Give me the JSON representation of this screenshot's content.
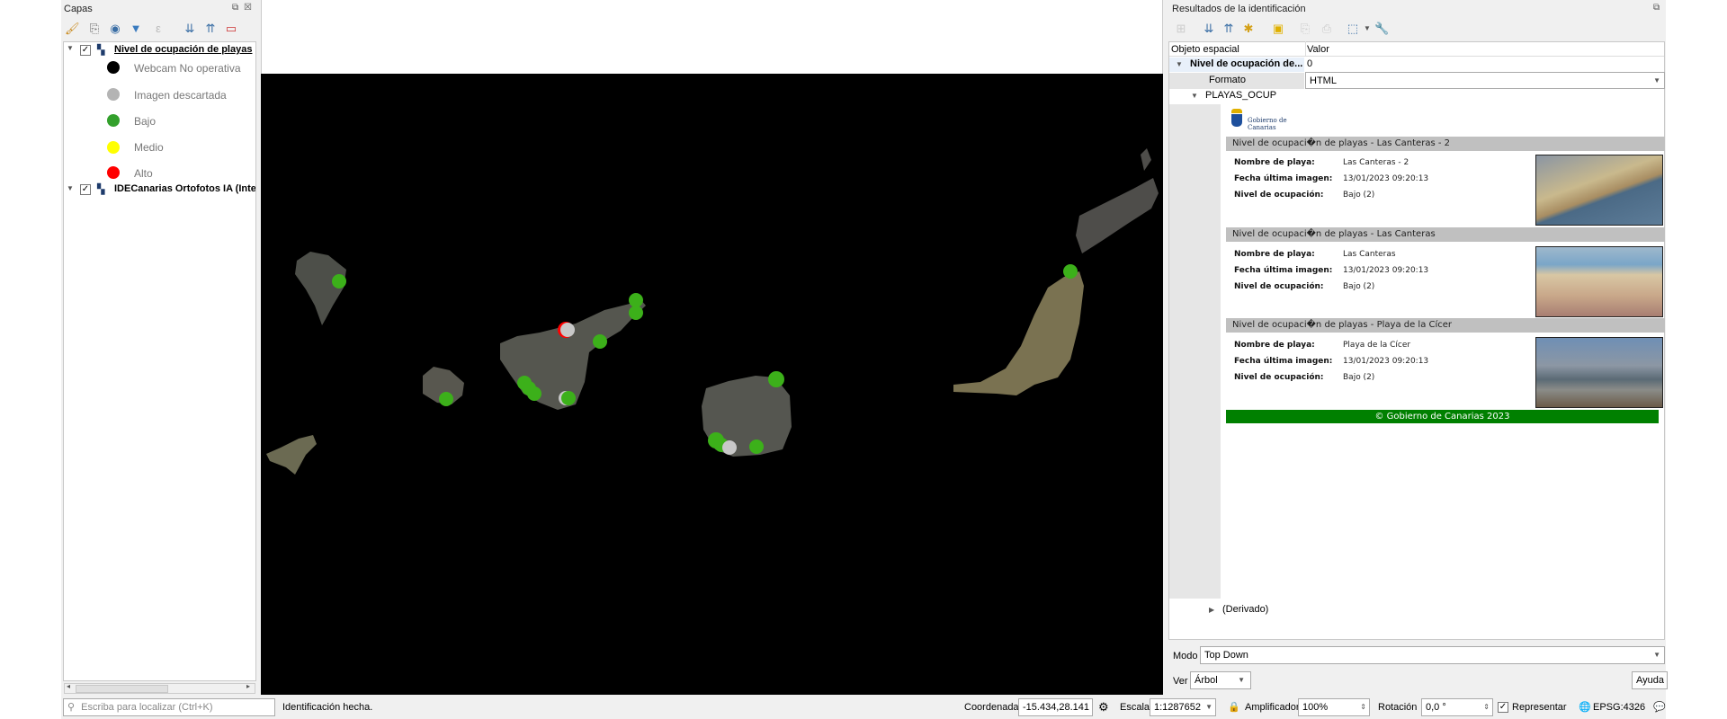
{
  "layers_panel": {
    "title": "Capas",
    "toolbar_icons": [
      "style-brush-icon",
      "add-group-icon",
      "eye-visibility-icon",
      "filter-icon",
      "expression-filter-icon",
      "expand-all-icon",
      "collapse-all-icon",
      "remove-layer-icon"
    ],
    "layers": [
      {
        "name": "Nivel de ocupación de playas",
        "checked": true,
        "legend": [
          {
            "label": "Webcam No operativa",
            "color": "#000000"
          },
          {
            "label": "Imagen descartada",
            "color": "#b4b4b4"
          },
          {
            "label": "Bajo",
            "color": "#33a02c"
          },
          {
            "label": "Medio",
            "color": "#ffff00"
          },
          {
            "label": "Alto",
            "color": "#ff0000"
          }
        ]
      },
      {
        "name": "IDECanarias Ortofotos IA (Inte",
        "checked": true
      }
    ]
  },
  "results_panel": {
    "title": "Resultados de la identificación",
    "columns": [
      "Objeto espacial",
      "Valor"
    ],
    "layer_row": {
      "name": "Nivel de ocupación de...",
      "value": "0"
    },
    "format_row": {
      "label": "Formato",
      "value": "HTML"
    },
    "feature": "PLAYAS_OCUP",
    "logo_text": "Gobierno de Canarias",
    "records": [
      {
        "title": "Nivel de ocupaci�n de playas - Las Canteras - 2",
        "nombre": "Las Canteras - 2",
        "fecha": "13/01/2023 09:20:13",
        "nivel": "Bajo (2)"
      },
      {
        "title": "Nivel de ocupaci�n de playas - Las Canteras",
        "nombre": "Las Canteras",
        "fecha": "13/01/2023 09:20:13",
        "nivel": "Bajo (2)"
      },
      {
        "title": "Nivel de ocupaci�n de playas - Playa de la Cícer",
        "nombre": "Playa de la Cícer",
        "fecha": "13/01/2023 09:20:13",
        "nivel": "Bajo (2)"
      }
    ],
    "field_labels": {
      "nombre": "Nombre de playa:",
      "fecha": "Fecha última imagen:",
      "nivel": "Nivel de ocupación:"
    },
    "footer": "© Gobierno de Canarias 2023",
    "footer_color": "#008000",
    "derived": "(Derivado)",
    "mode_label": "Modo",
    "mode_value": "Top Down",
    "view_label": "Ver",
    "view_value": "Árbol",
    "help_button": "Ayuda"
  },
  "statusbar": {
    "locator_placeholder": "Escriba para localizar (Ctrl+K)",
    "message": "Identificación hecha.",
    "coord_label": "Coordenada",
    "coord_value": "-15.434,28.141",
    "scale_label": "Escala",
    "scale_value": "1:1287652",
    "magnifier_label": "Amplificador",
    "magnifier_value": "100%",
    "rotation_label": "Rotación",
    "rotation_value": "0,0 °",
    "render_label": "Representar",
    "render_checked": true,
    "crs": "EPSG:4326"
  }
}
